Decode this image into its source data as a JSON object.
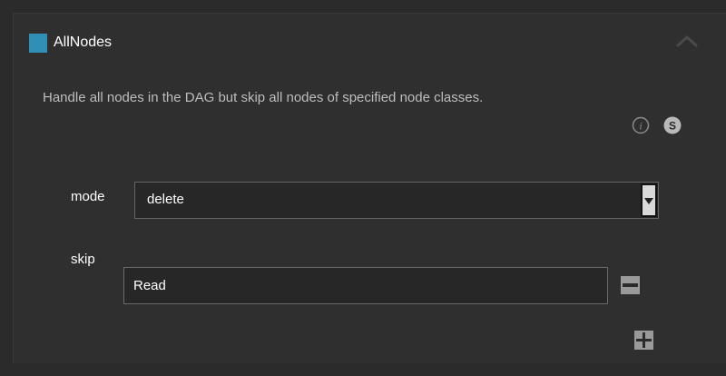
{
  "header": {
    "title": "AllNodes",
    "swatch_color": "#2f8fb6",
    "collapse_icon": "chevron-up-icon"
  },
  "description": "Handle all nodes in the DAG but skip all nodes of specified node classes.",
  "badges": {
    "info_icon": "info-icon",
    "scope_label": "S"
  },
  "fields": {
    "mode": {
      "label": "mode",
      "value": "delete"
    },
    "skip": {
      "label": "skip",
      "value": "Read"
    }
  },
  "buttons": {
    "remove_icon": "minus-icon",
    "add_icon": "plus-icon"
  }
}
